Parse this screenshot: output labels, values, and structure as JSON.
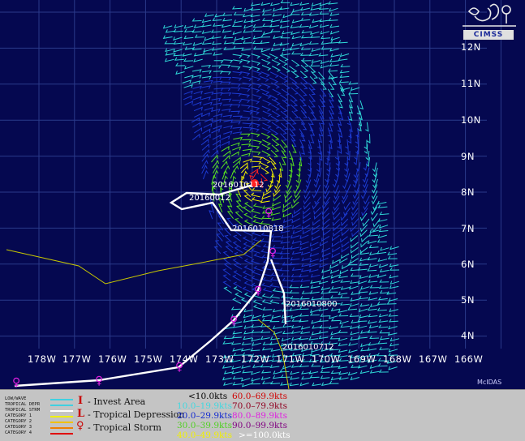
{
  "map": {
    "lat_labels": [
      "12N",
      "11N",
      "10N",
      "9N",
      "8N",
      "7N",
      "6N",
      "5N",
      "4N"
    ],
    "lon_labels": [
      "178W",
      "177W",
      "176W",
      "175W",
      "174W",
      "173W",
      "172W",
      "171W",
      "170W",
      "169W",
      "168W",
      "167W",
      "166W"
    ],
    "date_labels": [
      "2016010112",
      "20160012",
      "2016010818",
      "2016010800",
      "2016010712"
    ],
    "logo_text": "CIMSS",
    "footer_tag": "McIDAS",
    "colors": {
      "background": "#050850",
      "grid": "#2a3a8a",
      "track": "#ffffff",
      "coast": "#c8c800",
      "cyan": "#2fd8d8",
      "blue": "#1c3ad0",
      "green": "#58e020",
      "yellow": "#f0f000",
      "red": "#ff2020",
      "magenta": "#e020e0"
    }
  },
  "legend": {
    "track_types": [
      {
        "label": "LOW/WAVE",
        "color": "#40d0e0"
      },
      {
        "label": "TROPICAL DEPR",
        "color": "#40d0e0"
      },
      {
        "label": "TROPICAL STRM",
        "color": "#ffffff"
      },
      {
        "label": "CATEGORY 1",
        "color": "#f0f000"
      },
      {
        "label": "CATEGORY 2",
        "color": "#f0c000"
      },
      {
        "label": "CATEGORY 3",
        "color": "#f08000"
      },
      {
        "label": "CATEGORY 4",
        "color": "#e00000"
      }
    ],
    "symbols": [
      {
        "glyph": "I",
        "label": "- Invest Area"
      },
      {
        "glyph": "L",
        "label": "- Tropical Depression"
      },
      {
        "glyph": "♀",
        "label": "- Tropical Storm"
      }
    ],
    "speeds": [
      {
        "label": "<10.0kts",
        "color": "#000000"
      },
      {
        "label": "60.0–69.9kts",
        "color": "#d00000"
      },
      {
        "label": "10.0–19.9kts",
        "color": "#40d8e0"
      },
      {
        "label": "70.0–79.9kts",
        "color": "#900020"
      },
      {
        "label": "20.0–29.9kts",
        "color": "#1028d0"
      },
      {
        "label": "80.0–89.9kts",
        "color": "#e020e0"
      },
      {
        "label": "30.0–39.9kts",
        "color": "#50d020"
      },
      {
        "label": "90.0–99.9kts",
        "color": "#800080"
      },
      {
        "label": "40.0–49.9kts",
        "color": "#f0f000"
      },
      {
        "label": ">=100.0kts",
        "color": "#ffffff"
      }
    ]
  }
}
